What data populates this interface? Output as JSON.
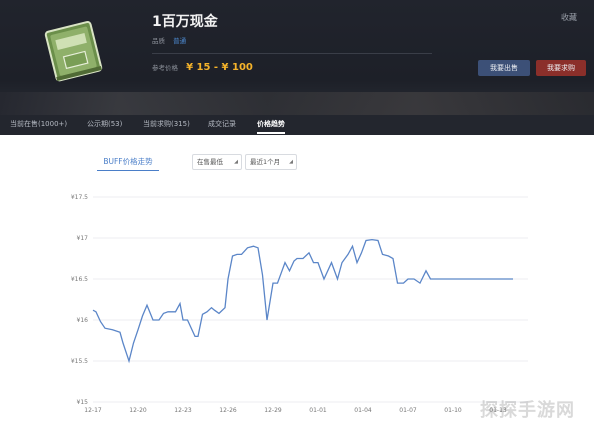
{
  "item": {
    "title": "1百万现金",
    "favorite_label": "收藏",
    "quality_label": "品质",
    "quality_value": "普通",
    "price_label": "参考价格",
    "price_range": "¥ 15 - ¥ 100",
    "thumbnail_icon": "cash-bundle-icon"
  },
  "actions": {
    "sell_label": "我要出售",
    "buy_label": "我要求购"
  },
  "tabs": [
    {
      "label": "当前在售(1000+)",
      "active": false
    },
    {
      "label": "公示期(53)",
      "active": false
    },
    {
      "label": "当前求购(315)",
      "active": false
    },
    {
      "label": "成交记录",
      "active": false
    },
    {
      "label": "价格趋势",
      "active": true
    }
  ],
  "chart_controls": {
    "chart_tab_label": "BUFF价格走势",
    "filter_select": "在售最低",
    "range_select": "最近1个月"
  },
  "chart_data": {
    "type": "line",
    "xlabel": "",
    "ylabel": "",
    "ylim": [
      15,
      17.5
    ],
    "yticks": [
      "¥17.5",
      "¥17",
      "¥16.5",
      "¥16",
      "¥15.5",
      "¥15"
    ],
    "xticks": [
      "12-17",
      "12-20",
      "12-23",
      "12-26",
      "12-29",
      "01-01",
      "01-04",
      "01-07",
      "01-10",
      "01-13"
    ],
    "line_color": "#5b86c8",
    "grid": true,
    "series": [
      {
        "x": [
          0,
          0.2,
          0.5,
          0.8,
          1.3,
          1.8,
          2.0,
          2.4,
          2.7,
          3.0,
          3.3,
          3.6,
          4.0,
          4.4,
          4.7,
          5.0,
          5.5,
          5.8,
          6.0,
          6.3,
          6.8,
          7.0,
          7.3,
          7.6,
          7.9,
          8.1,
          8.4,
          8.8,
          9.0,
          9.3,
          9.6,
          9.9,
          10.3,
          10.7,
          11.0,
          11.3,
          11.6,
          12.0,
          12.3,
          12.6,
          12.8,
          13.1,
          13.4,
          13.6,
          14.0,
          14.4,
          14.7,
          15.0,
          15.4,
          15.9,
          16.3,
          16.6,
          17.0,
          17.3,
          17.6,
          17.9,
          18.2,
          18.6,
          19.0,
          19.3,
          19.7,
          20.0,
          20.3,
          20.7,
          21.0,
          21.4,
          21.8,
          22.2,
          22.5,
          22.8,
          23.1,
          23.4,
          23.8,
          24.0,
          24.3,
          24.6,
          25.0,
          25.3,
          25.5,
          25.7,
          26.0,
          26.4,
          26.7,
          27.0,
          27.3,
          27.7,
          28.0,
          28.3,
          28.6,
          28.8,
          29.0
        ],
        "y": [
          16.12,
          16.1,
          15.98,
          15.9,
          15.88,
          15.85,
          15.72,
          15.5,
          15.72,
          15.88,
          16.05,
          16.18,
          16.0,
          16.0,
          16.08,
          16.1,
          16.1,
          16.2,
          16.0,
          16.0,
          15.8,
          15.8,
          16.07,
          16.1,
          16.15,
          16.12,
          16.08,
          16.15,
          16.5,
          16.78,
          16.8,
          16.8,
          16.88,
          16.9,
          16.88,
          16.55,
          16.0,
          16.45,
          16.45,
          16.6,
          16.7,
          16.6,
          16.72,
          16.75,
          16.75,
          16.82,
          16.7,
          16.7,
          16.5,
          16.7,
          16.5,
          16.7,
          16.8,
          16.9,
          16.7,
          16.82,
          16.97,
          16.98,
          16.97,
          16.8,
          16.78,
          16.75,
          16.45,
          16.45,
          16.5,
          16.5,
          16.45,
          16.6,
          16.5,
          16.5,
          16.5,
          16.5,
          16.5,
          16.5,
          16.5,
          16.5,
          16.5,
          16.5,
          16.5,
          16.5,
          16.5,
          16.5,
          16.5,
          16.5,
          16.5,
          16.5,
          16.5,
          16.5,
          16.5,
          16.5,
          16.5
        ]
      }
    ]
  },
  "watermark": "探探手游网"
}
